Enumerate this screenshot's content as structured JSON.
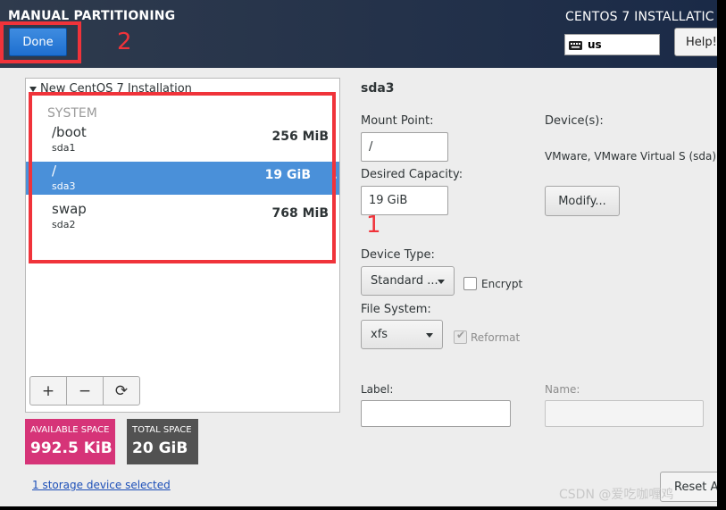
{
  "header": {
    "page_title": "MANUAL PARTITIONING",
    "product_title": "CENTOS 7 INSTALLATIC",
    "done_label": "Done",
    "keyboard_layout": "us",
    "help_label": "Help!"
  },
  "annotations": [
    "1",
    "2"
  ],
  "partitions": {
    "install_title": "New CentOS 7 Installation",
    "system_header": "SYSTEM",
    "rows": [
      {
        "mount": "/boot",
        "device": "sda1",
        "size": "256 MiB"
      },
      {
        "mount": "/",
        "device": "sda3",
        "size": "19 GiB",
        "selected": true
      },
      {
        "mount": "swap",
        "device": "sda2",
        "size": "768 MiB"
      }
    ],
    "toolbar": [
      "+",
      "−",
      "⟳"
    ]
  },
  "space": {
    "available_label": "AVAILABLE SPACE",
    "available_value": "992.5 KiB",
    "total_label": "TOTAL SPACE",
    "total_value": "20 GiB"
  },
  "storage_link": "1 storage device selected",
  "details": {
    "title": "sda3",
    "mount_point_label": "Mount Point:",
    "mount_point_value": "/",
    "capacity_label": "Desired Capacity:",
    "capacity_value": "19 GiB",
    "devices_label": "Device(s):",
    "devices_value": "VMware, VMware Virtual S (sda)",
    "modify_label": "Modify...",
    "device_type_label": "Device Type:",
    "device_type_value": "Standard ...",
    "encrypt_label": "Encrypt",
    "file_system_label": "File System:",
    "file_system_value": "xfs",
    "reformat_label": "Reformat",
    "reformat_checked": true,
    "label_label": "Label:",
    "name_label": "Name:",
    "reset_label": "Reset Al"
  },
  "watermark": "CSDN @爱吃咖喱鸡",
  "colors": {
    "header_bg": "#24324a",
    "selection": "#4a90d9",
    "available": "#d63478",
    "total": "#525252",
    "annotation": "#f0333a"
  }
}
